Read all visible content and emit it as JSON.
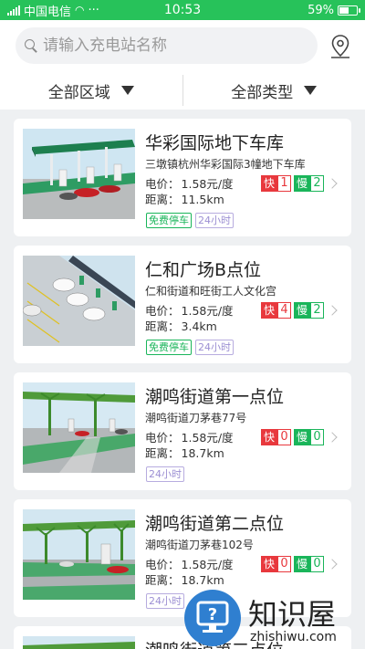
{
  "status_bar": {
    "carrier": "中国电信",
    "time": "10:53",
    "battery": "59%",
    "battery_level": 0.59
  },
  "search": {
    "placeholder": "请输入充电站名称"
  },
  "filters": [
    {
      "label": "全部区域"
    },
    {
      "label": "全部类型"
    }
  ],
  "labels": {
    "price": "电价：",
    "distance": "距离：",
    "fast": "快",
    "slow": "慢"
  },
  "stations": [
    {
      "name": "华彩国际地下车库",
      "address": "三墩镇杭州华彩国际3幢地下车库",
      "price": "1.58元/度",
      "distance": "11.5km",
      "fast": "1",
      "slow": "2",
      "tags": [
        "免费停车",
        "24小时"
      ]
    },
    {
      "name": "仁和广场B点位",
      "address": "仁和街道和旺街工人文化宫",
      "price": "1.58元/度",
      "distance": "3.4km",
      "fast": "4",
      "slow": "2",
      "tags": [
        "免费停车",
        "24小时"
      ]
    },
    {
      "name": "潮鸣街道第一点位",
      "address": "潮鸣街道刀茅巷77号",
      "price": "1.58元/度",
      "distance": "18.7km",
      "fast": "0",
      "slow": "0",
      "tags": [
        "24小时"
      ]
    },
    {
      "name": "潮鸣街道第二点位",
      "address": "潮鸣街道刀茅巷102号",
      "price": "1.58元/度",
      "distance": "18.7km",
      "fast": "0",
      "slow": "0",
      "tags": [
        "24小时"
      ]
    },
    {
      "name": "潮鸣街道第三点位"
    }
  ],
  "watermark": {
    "title": "知识屋",
    "url": "zhishiwu.com"
  },
  "colors": {
    "brand_green": "#27c25a",
    "fast_red": "#e8383d",
    "slow_green": "#1ab55a",
    "tag_purple": "#9c8fd3"
  }
}
